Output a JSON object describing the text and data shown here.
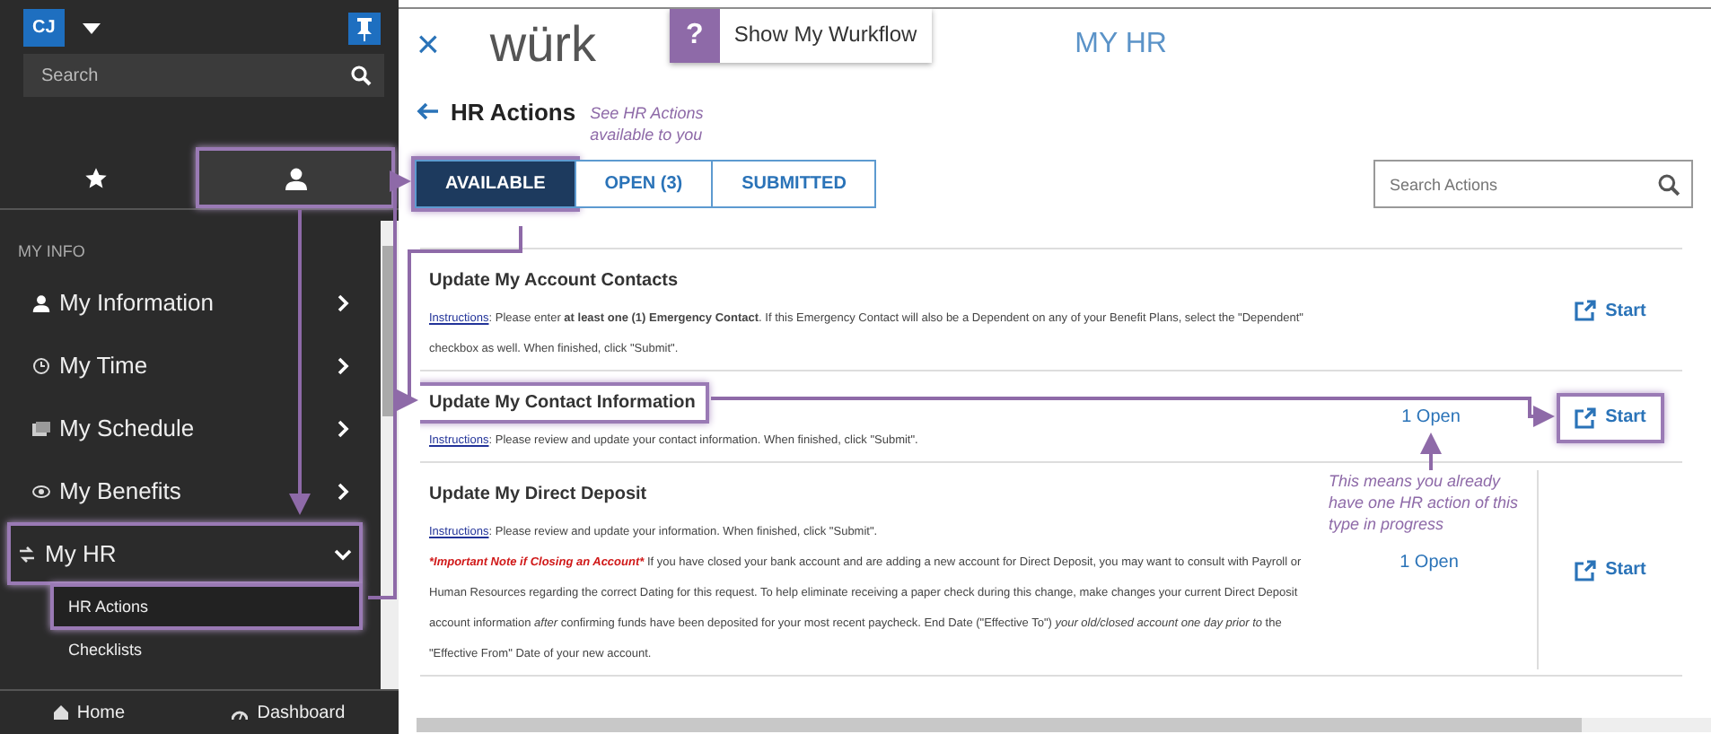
{
  "sidebar": {
    "avatar": "CJ",
    "search": {
      "placeholder": "Search"
    },
    "nav_tabs": [
      {
        "selected": false,
        "highlighted": false
      },
      {
        "selected": true,
        "highlighted": true
      }
    ],
    "section_label": "MY INFO",
    "items": [
      {
        "label": "My Information",
        "expanded": false,
        "highlighted": false
      },
      {
        "label": "My Time",
        "expanded": false,
        "highlighted": false
      },
      {
        "label": "My Schedule",
        "expanded": false,
        "highlighted": false
      },
      {
        "label": "My Benefits",
        "expanded": false,
        "highlighted": false
      },
      {
        "label": "My HR",
        "expanded": true,
        "highlighted": true,
        "children": [
          {
            "label": "HR Actions",
            "selected": true,
            "highlighted": true
          },
          {
            "label": "Checklists",
            "selected": false,
            "highlighted": false
          }
        ]
      }
    ],
    "footer": [
      {
        "label": "Home"
      },
      {
        "label": "Dashboard"
      }
    ]
  },
  "header": {
    "close": "×",
    "logo": "würk",
    "help": "?",
    "workflow": "Show My Wurkflow",
    "title": "MY HR"
  },
  "page_title": "HR Actions",
  "tab_note": "See HR Actions available to you",
  "tabs": [
    {
      "label": "AVAILABLE",
      "selected": true,
      "highlighted": true
    },
    {
      "label": "OPEN (3)",
      "selected": false,
      "highlighted": false
    },
    {
      "label": "SUBMITTED",
      "selected": false,
      "highlighted": false
    }
  ],
  "search": {
    "placeholder": "Search Actions"
  },
  "actions": [
    {
      "title": "Update My Account Contacts",
      "highlighted": false,
      "link": "Instructions",
      "text": ": Please enter **at least one (1) Emergency Contact**. If this Emergency Contact will also be a Dependent on any of your Benefit Plans, select the \"Dependent\" checkbox as well.  When finished, click \"Submit\".",
      "start": "Start",
      "start_highlighted": false
    },
    {
      "title": "Update My Contact Information",
      "highlighted": true,
      "link": "Instructions",
      "text": ": Please review and update your contact information. When finished, click \"Submit\".",
      "open": "1 Open",
      "start": "Start",
      "start_highlighted": true
    },
    {
      "title": "Update My Direct Deposit",
      "highlighted": false,
      "link": "Instructions",
      "text": ": Please review and update your information. When finished, click \"Submit\".",
      "note_label": "*Important Note if Closing an Account*",
      "note": " If you have closed your bank account and are adding a new account for Direct Deposit, you may want to consult with Payroll or Human Resources regarding the correct Dating for this request. To help eliminate receiving a paper check during this change, make changes your current Direct Deposit account information *after* confirming funds have been deposited for your most recent paycheck. End Date (\"Effective To\") *your old/closed account one day prior to* the \"Effective From\" Date of your new account.",
      "open_note": "This means you already have one HR action of this type in progress",
      "open": "1 Open",
      "start": "Start",
      "start_highlighted": false
    }
  ]
}
